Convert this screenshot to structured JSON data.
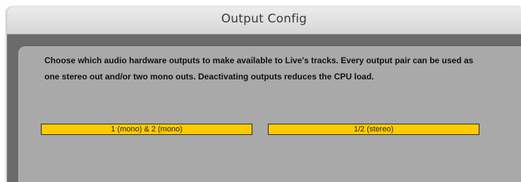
{
  "window": {
    "title": "Output Config"
  },
  "panel": {
    "description": "Choose which audio hardware outputs to make available to Live's tracks. Every output pair can be used as one stereo out and/or two mono outs.  Deactivating outputs reduces the CPU load."
  },
  "outputs": [
    {
      "label": "1 (mono) & 2 (mono)",
      "active": true
    },
    {
      "label": "1/2 (stereo)",
      "active": true
    }
  ],
  "colors": {
    "active_output": "#ffcc00",
    "panel_background": "#a9a9a9",
    "frame_background": "#6b6b6b"
  }
}
